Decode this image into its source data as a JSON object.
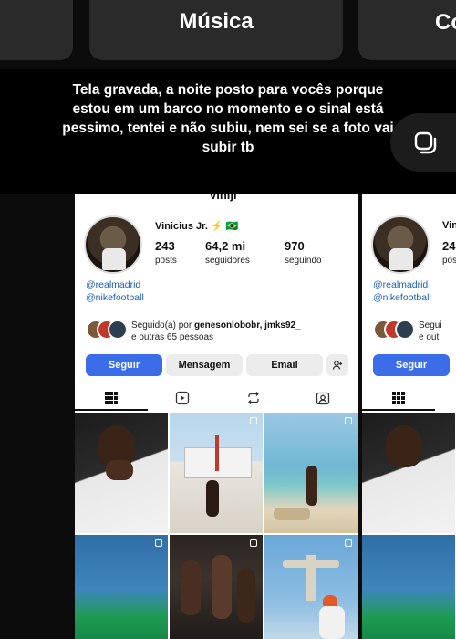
{
  "pills": {
    "center": "Música",
    "right": "Co"
  },
  "caption": "Tela gravada, a noite posto para vocês porque estou em um barco no momento e o sinal está pessimo, tentei e não subiu, nem sei se a foto vai subir tb",
  "profile": {
    "username": "viniji",
    "display_name": "Vinicius Jr. ⚡️ 🇧🇷",
    "stats": [
      {
        "value": "243",
        "label": "posts"
      },
      {
        "value": "64,2 mi",
        "label": "seguidores"
      },
      {
        "value": "970",
        "label": "seguindo"
      }
    ],
    "links": [
      "@realmadrid",
      "@nikefootball"
    ],
    "followed_by_prefix": "Seguido(a) por ",
    "followed_by_names": "genesonlobobr, jmks92_",
    "followed_by_suffix": "e outras 65 pessoas",
    "buttons": {
      "follow": "Seguir",
      "message": "Mensagem",
      "email": "Email"
    }
  },
  "side_shot": {
    "display_name_partial": "Vin",
    "stat_partial": "24",
    "stat_label_partial": "pos",
    "links": [
      "@realmadrid",
      "@nikefootball"
    ],
    "followed_partial": "Segui",
    "followed_suffix_partial": "e out",
    "follow_button": "Seguir"
  },
  "tabs": [
    "grid-icon",
    "reels-icon",
    "repost-icon",
    "tagged-icon"
  ],
  "colors": {
    "follow_blue": "#3b6de8",
    "link_blue": "#1a5fb4"
  }
}
